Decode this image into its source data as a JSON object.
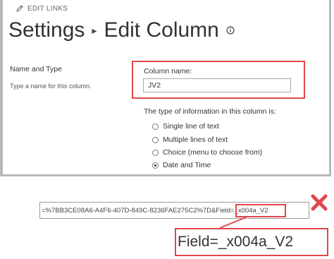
{
  "header": {
    "edit_links": "EDIT LINKS",
    "title_part1": "Settings",
    "separator": "▸",
    "title_part2": "Edit Column"
  },
  "name_section": {
    "heading": "Name and Type",
    "description": "Type a name for this column.",
    "column_name_label": "Column name:",
    "column_name_value": "JV2"
  },
  "type_section": {
    "label": "The type of information in this column is:",
    "options": [
      {
        "label": "Single line of text",
        "selected": false
      },
      {
        "label": "Multiple lines of text",
        "selected": false
      },
      {
        "label": "Choice (menu to choose from)",
        "selected": false
      },
      {
        "label": "Date and Time",
        "selected": true
      }
    ]
  },
  "url": {
    "text": "=%7BB3CE08A6-A4F6-407D-849C-8236FAE275C2%7D&Field=_x004a_V2",
    "zoom_text": "Field=_x004a_V2"
  },
  "colors": {
    "highlight": "#e0474c",
    "cross": "#e0474c"
  },
  "icons": {
    "edit": "pencil-icon",
    "info": "info-icon",
    "error": "close-icon"
  }
}
